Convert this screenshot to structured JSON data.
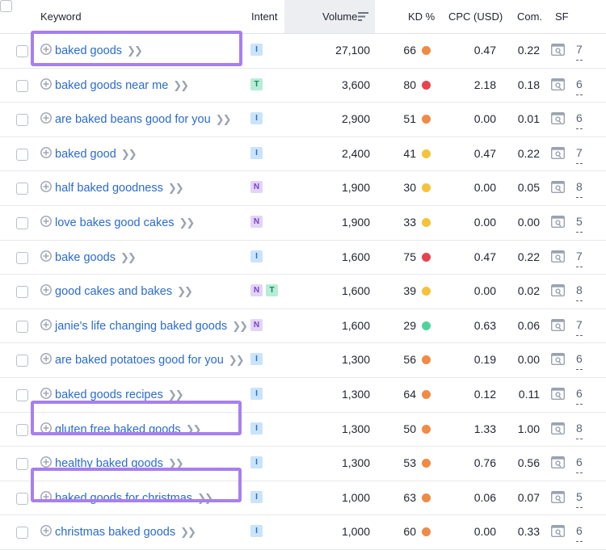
{
  "header": {
    "keyword": "Keyword",
    "intent": "Intent",
    "volume": "Volume",
    "kd": "KD %",
    "cpc": "CPC (USD)",
    "com": "Com.",
    "sf": "SF"
  },
  "colors": {
    "kd_orange": "#f08a44",
    "kd_yellow": "#f4c33a",
    "kd_red": "#e8424f",
    "kd_green": "#52d29a",
    "highlight": "#a87ff0",
    "link": "#2a6bcf"
  },
  "icons": {
    "add": "plus-circle-icon",
    "more": "double-chevron-right-icon",
    "sort": "sort-descending-icon",
    "serp": "serp-features-icon"
  },
  "rows": [
    {
      "keyword": "baked goods",
      "intent": [
        "I"
      ],
      "volume": "27,100",
      "kd": "66",
      "kd_color": "#f08a44",
      "cpc": "0.47",
      "com": "0.22",
      "sf": "7",
      "highlighted": true
    },
    {
      "keyword": "baked goods near me",
      "intent": [
        "T"
      ],
      "volume": "3,600",
      "kd": "80",
      "kd_color": "#e8424f",
      "cpc": "2.18",
      "com": "0.18",
      "sf": "6",
      "highlighted": false
    },
    {
      "keyword": "are baked beans good for you",
      "intent": [
        "I"
      ],
      "volume": "2,900",
      "kd": "51",
      "kd_color": "#f08a44",
      "cpc": "0.00",
      "com": "0.01",
      "sf": "6",
      "highlighted": false
    },
    {
      "keyword": "baked good",
      "intent": [
        "I"
      ],
      "volume": "2,400",
      "kd": "41",
      "kd_color": "#f4c33a",
      "cpc": "0.47",
      "com": "0.22",
      "sf": "7",
      "highlighted": false
    },
    {
      "keyword": "half baked goodness",
      "intent": [
        "N"
      ],
      "volume": "1,900",
      "kd": "30",
      "kd_color": "#f4c33a",
      "cpc": "0.00",
      "com": "0.05",
      "sf": "8",
      "highlighted": false
    },
    {
      "keyword": "love bakes good cakes",
      "intent": [
        "N"
      ],
      "volume": "1,900",
      "kd": "33",
      "kd_color": "#f4c33a",
      "cpc": "0.00",
      "com": "0.00",
      "sf": "5",
      "highlighted": false
    },
    {
      "keyword": "bake goods",
      "intent": [
        "I"
      ],
      "volume": "1,600",
      "kd": "75",
      "kd_color": "#e8424f",
      "cpc": "0.47",
      "com": "0.22",
      "sf": "7",
      "highlighted": false
    },
    {
      "keyword": "good cakes and bakes",
      "intent": [
        "N",
        "T"
      ],
      "volume": "1,600",
      "kd": "39",
      "kd_color": "#f4c33a",
      "cpc": "0.00",
      "com": "0.02",
      "sf": "8",
      "highlighted": false
    },
    {
      "keyword": "janie's life changing baked goods",
      "intent": [
        "N"
      ],
      "volume": "1,600",
      "kd": "29",
      "kd_color": "#52d29a",
      "cpc": "0.63",
      "com": "0.06",
      "sf": "7",
      "highlighted": false
    },
    {
      "keyword": "are baked potatoes good for you",
      "intent": [
        "I"
      ],
      "volume": "1,300",
      "kd": "56",
      "kd_color": "#f08a44",
      "cpc": "0.19",
      "com": "0.00",
      "sf": "6",
      "highlighted": false
    },
    {
      "keyword": "baked goods recipes",
      "intent": [
        "I"
      ],
      "volume": "1,300",
      "kd": "64",
      "kd_color": "#f08a44",
      "cpc": "0.12",
      "com": "0.11",
      "sf": "6",
      "highlighted": false
    },
    {
      "keyword": "gluten free baked goods",
      "intent": [
        "I"
      ],
      "volume": "1,300",
      "kd": "50",
      "kd_color": "#f08a44",
      "cpc": "1.33",
      "com": "1.00",
      "sf": "8",
      "highlighted": true
    },
    {
      "keyword": "healthy baked goods",
      "intent": [
        "I"
      ],
      "volume": "1,300",
      "kd": "53",
      "kd_color": "#f08a44",
      "cpc": "0.76",
      "com": "0.56",
      "sf": "6",
      "highlighted": false
    },
    {
      "keyword": "baked goods for christmas",
      "intent": [
        "I"
      ],
      "volume": "1,000",
      "kd": "63",
      "kd_color": "#f08a44",
      "cpc": "0.06",
      "com": "0.07",
      "sf": "5",
      "highlighted": true
    },
    {
      "keyword": "christmas baked goods",
      "intent": [
        "I"
      ],
      "volume": "1,000",
      "kd": "60",
      "kd_color": "#f08a44",
      "cpc": "0.00",
      "com": "0.33",
      "sf": "6",
      "highlighted": false
    }
  ]
}
